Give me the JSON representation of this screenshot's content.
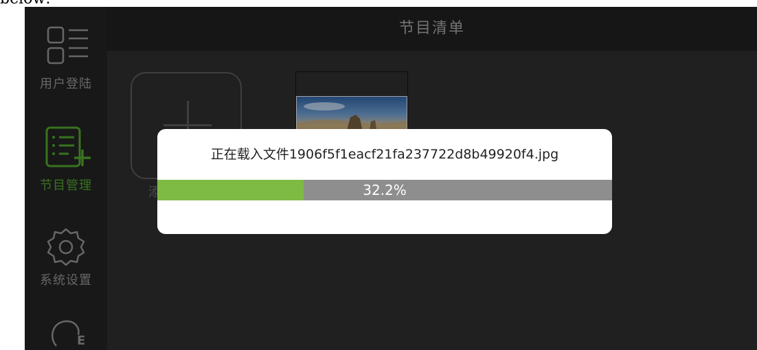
{
  "caption": "below:",
  "sidebar": {
    "items": [
      {
        "label": "用户登陆",
        "icon": "user-login-icon",
        "active": false
      },
      {
        "label": "节目管理",
        "icon": "program-list-add-icon",
        "active": true
      },
      {
        "label": "系统设置",
        "icon": "gear-icon",
        "active": false
      },
      {
        "label": "",
        "icon": "info-icon",
        "active": false
      }
    ]
  },
  "header": {
    "title": "节目清单"
  },
  "content": {
    "add_tile_label": "添",
    "thumbnail_icon": "landscape-thumbnail"
  },
  "dialog": {
    "message": "正在载入文件1906f5f1eacf21fa237722d8b49920f4.jpg",
    "progress_text": "32.2%",
    "progress_value": 0.322
  },
  "colors": {
    "accent_green": "#7dbb44",
    "active_nav_green": "#4c9a2a",
    "progress_track": "#8e8e8e",
    "sidebar_bg": "#202020",
    "content_bg": "#2b2b2b"
  }
}
